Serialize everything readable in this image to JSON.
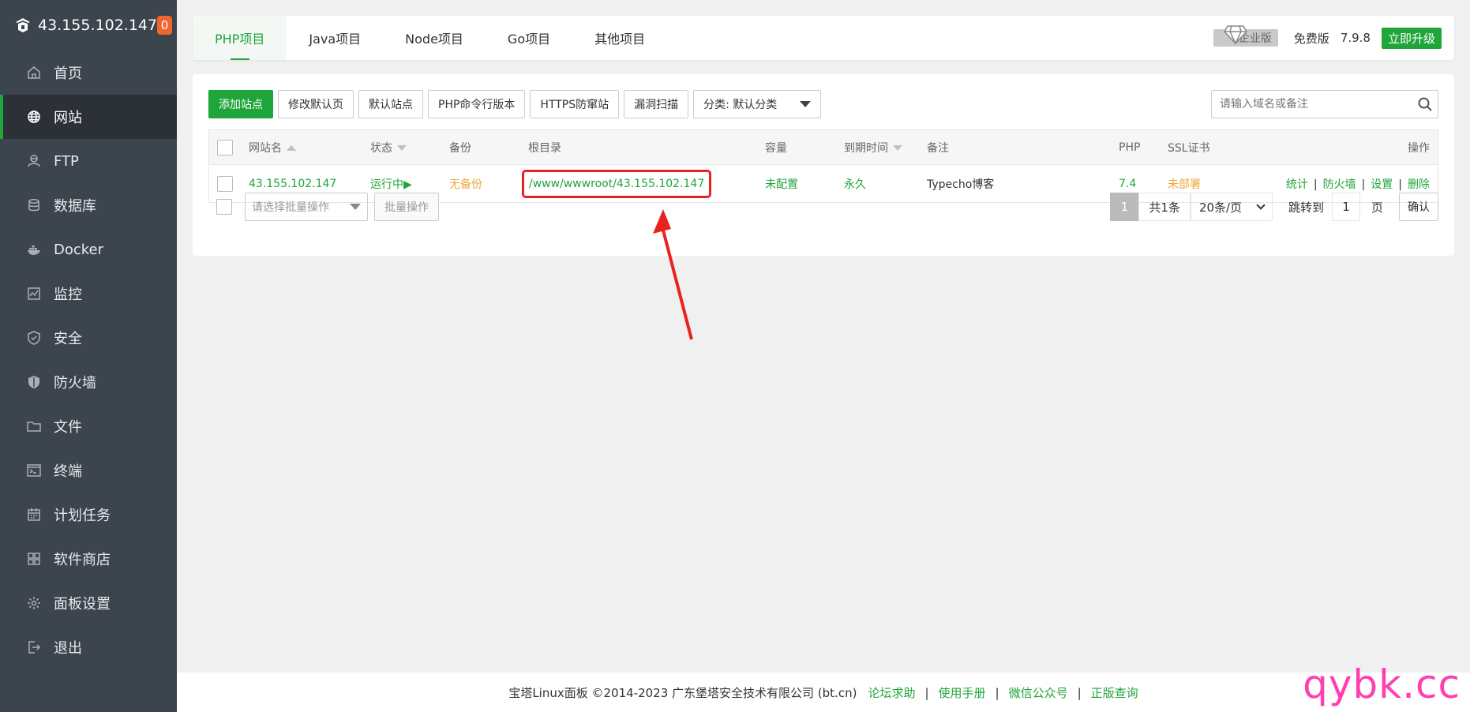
{
  "sidebar": {
    "server_ip": "43.155.102.147",
    "badge": "0",
    "items": [
      {
        "label": "首页",
        "icon": "home-icon"
      },
      {
        "label": "网站",
        "icon": "globe-icon"
      },
      {
        "label": "FTP",
        "icon": "ftp-icon"
      },
      {
        "label": "数据库",
        "icon": "database-icon"
      },
      {
        "label": "Docker",
        "icon": "docker-icon"
      },
      {
        "label": "监控",
        "icon": "monitor-icon"
      },
      {
        "label": "安全",
        "icon": "shield-check-icon"
      },
      {
        "label": "防火墙",
        "icon": "firewall-icon"
      },
      {
        "label": "文件",
        "icon": "folder-icon"
      },
      {
        "label": "终端",
        "icon": "terminal-icon"
      },
      {
        "label": "计划任务",
        "icon": "calendar-icon"
      },
      {
        "label": "软件商店",
        "icon": "apps-icon"
      },
      {
        "label": "面板设置",
        "icon": "gear-icon"
      },
      {
        "label": "退出",
        "icon": "logout-icon"
      }
    ],
    "active_index": 1
  },
  "tabs": [
    "PHP项目",
    "Java项目",
    "Node项目",
    "Go项目",
    "其他项目"
  ],
  "topright": {
    "enterprise": "企业版",
    "free": "免费版",
    "version": "7.9.8",
    "upgrade": "立即升级"
  },
  "toolbar": {
    "add_site": "添加站点",
    "edit_default": "修改默认页",
    "default_site": "默认站点",
    "php_cli": "PHP命令行版本",
    "https_guard": "HTTPS防窜站",
    "vuln_scan": "漏洞扫描",
    "category": "分类: 默认分类",
    "search_placeholder": "请输入域名或备注"
  },
  "table": {
    "headers": {
      "name": "网站名",
      "status": "状态",
      "backup": "备份",
      "root": "根目录",
      "capacity": "容量",
      "expire": "到期时间",
      "remark": "备注",
      "php": "PHP",
      "ssl": "SSL证书",
      "ops": "操作"
    },
    "rows": [
      {
        "name": "43.155.102.147",
        "status": "运行中▶",
        "backup": "无备份",
        "root": "/www/wwwroot/43.155.102.147",
        "capacity": "未配置",
        "expire": "永久",
        "remark": "Typecho博客",
        "php": "7.4",
        "ssl": "未部署",
        "ops": [
          "统计",
          "防火墙",
          "设置",
          "删除"
        ]
      }
    ]
  },
  "batch": {
    "select_placeholder": "请选择批量操作",
    "button": "批量操作"
  },
  "pager": {
    "current": "1",
    "total": "共1条",
    "page_size": "20条/页",
    "jump_label": "跳转到",
    "jump_value": "1",
    "unit": "页",
    "confirm": "确认"
  },
  "footer": {
    "copyright": "宝塔Linux面板 ©2014-2023 广东堡塔安全技术有限公司 (bt.cn)",
    "links": [
      "论坛求助",
      "使用手册",
      "微信公众号",
      "正版查询"
    ]
  },
  "watermark": "qybk.cc",
  "colors": {
    "accent": "#20a53a",
    "sidebar": "#3c444d",
    "warning": "#f0a73b",
    "highlight": "#e8231f",
    "watermark": "#ff3fb1"
  }
}
